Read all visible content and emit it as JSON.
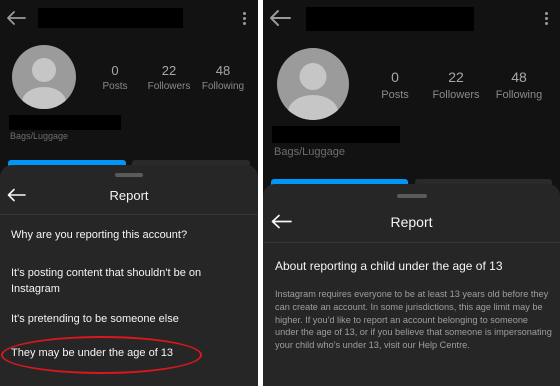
{
  "left_panel": {
    "profile": {
      "stats": [
        {
          "value": "0",
          "label": "Posts"
        },
        {
          "value": "22",
          "label": "Followers"
        },
        {
          "value": "48",
          "label": "Following"
        }
      ],
      "category": "Bags/Luggage"
    },
    "sheet": {
      "title": "Report",
      "question": "Why are you reporting this account?",
      "options": [
        "It's posting content that shouldn't be on Instagram",
        "It's pretending to be someone else",
        "They may be under the age of 13"
      ]
    }
  },
  "right_panel": {
    "profile": {
      "stats": [
        {
          "value": "0",
          "label": "Posts"
        },
        {
          "value": "22",
          "label": "Followers"
        },
        {
          "value": "48",
          "label": "Following"
        }
      ],
      "category": "Bags/Luggage"
    },
    "sheet": {
      "title": "Report",
      "heading": "About reporting a child under the age of 13",
      "body": "Instagram requires everyone to be at least 13 years old before they can create an account. In some jurisdictions, this age limit may be higher. If you'd like to report an account belonging to someone under the age of 13, or if you believe that someone is impersonating your child who's under 13, visit our Help Centre."
    }
  },
  "colors": {
    "highlight_circle": "#d9171c",
    "follow_button": "#0095f6"
  },
  "icons": [
    "back-arrow-icon",
    "more-options-icon",
    "avatar-placeholder-icon"
  ]
}
